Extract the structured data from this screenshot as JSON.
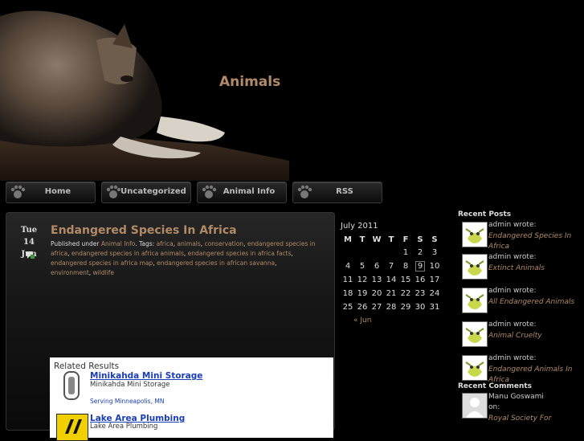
{
  "site": {
    "title": "Animals"
  },
  "nav": [
    {
      "label": "Home"
    },
    {
      "label": "Uncategorized"
    },
    {
      "label": "Animal Info"
    },
    {
      "label": "RSS"
    }
  ],
  "post": {
    "day": "Tue",
    "date": "14 Jun",
    "title": "Endangered Species In Africa",
    "published_under": "Published under",
    "category": "Animal Info",
    "tags_label": ". Tags:",
    "tags": [
      "africa",
      "animals",
      "conservation",
      "endangered species in africa",
      "endangered species in africa animals",
      "endangered species in africa facts",
      "endangered species in africa map",
      "endangered species in african savanna",
      "environment",
      "wildlife"
    ]
  },
  "related": {
    "heading": "Related Results",
    "items": [
      {
        "title": "Minikahda Mini Storage",
        "subtitle": "Minikahda Mini Storage",
        "link": "Serving Minneapolis, MN"
      },
      {
        "title": "Lake Area Plumbing",
        "subtitle": "Lake Area Plumbing"
      }
    ]
  },
  "calendar": {
    "title": "July 2011",
    "weekdays": [
      "M",
      "T",
      "W",
      "T",
      "F",
      "S",
      "S"
    ],
    "weeks": [
      [
        "",
        "",
        "",
        "",
        "1",
        "2",
        "3"
      ],
      [
        "4",
        "5",
        "6",
        "7",
        "8",
        "9",
        "10"
      ],
      [
        "11",
        "12",
        "13",
        "14",
        "15",
        "16",
        "17"
      ],
      [
        "18",
        "19",
        "20",
        "21",
        "22",
        "23",
        "24"
      ],
      [
        "25",
        "26",
        "27",
        "28",
        "29",
        "30",
        "31"
      ]
    ],
    "today": "9",
    "prev": "« Jun"
  },
  "sidebar": {
    "recent_posts_title": "Recent Posts",
    "recent_posts": [
      {
        "author": "admin wrote:",
        "title": "Endangered Species In Africa"
      },
      {
        "author": "admin wrote:",
        "title": "Extinct Animals"
      },
      {
        "author": "admin wrote:",
        "title": "All Endangered Animals"
      },
      {
        "author": "admin wrote:",
        "title": "Animal Cruelty"
      },
      {
        "author": "admin wrote:",
        "title": "Endangered Animals In Africa"
      }
    ],
    "recent_comments_title": "Recent Comments",
    "recent_comments": [
      {
        "author": "Manu Goswami",
        "on": "on:",
        "title": "Royal Society For"
      }
    ]
  },
  "colors": {
    "accent": "#b38a66",
    "background": "#000000",
    "link_blue": "#1a3db8"
  }
}
